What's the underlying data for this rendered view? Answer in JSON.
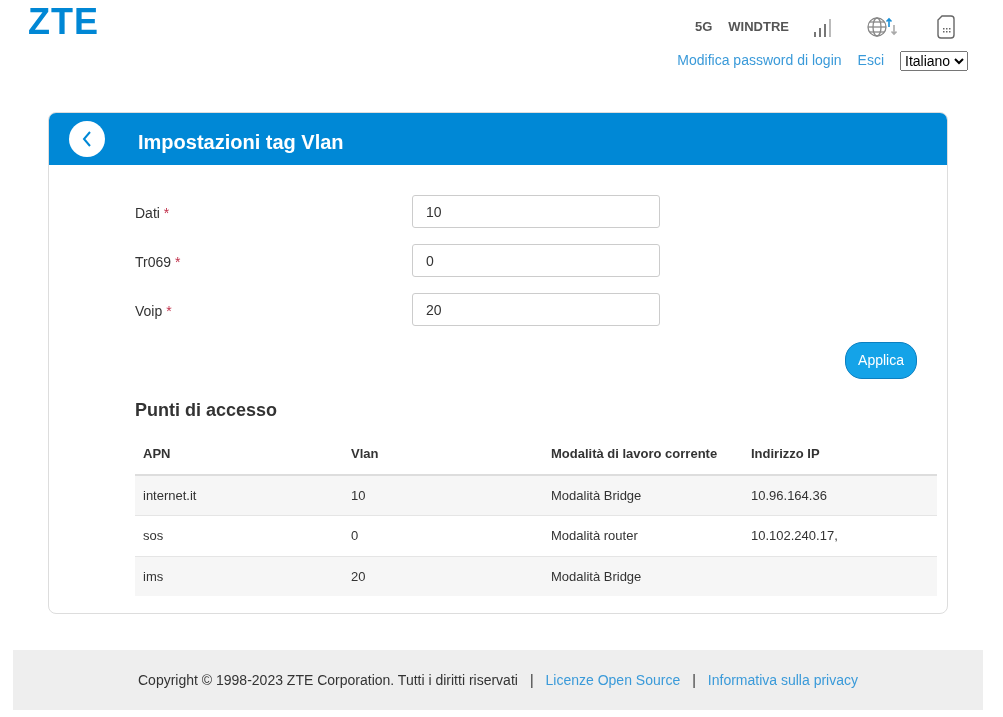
{
  "header": {
    "logo": "ZTE",
    "network": "5G",
    "carrier": "WINDTRE",
    "links": [
      "Modifica password di login",
      "Esci"
    ],
    "language": "Italiano"
  },
  "panel": {
    "title": "Impostazioni tag Vlan",
    "fields": [
      {
        "label": "Dati",
        "required_mark": "*",
        "value": "10"
      },
      {
        "label": "Tr069",
        "required_mark": "*",
        "value": "0"
      },
      {
        "label": "Voip",
        "required_mark": "*",
        "value": "20"
      }
    ],
    "apply_button": "Applica",
    "section_title": "Punti di accesso",
    "table": {
      "columns": [
        "APN",
        "Vlan",
        "Modalità di lavoro corrente",
        "Indirizzo IP"
      ],
      "rows": [
        [
          "internet.it",
          "10",
          "Modalità Bridge",
          "10.96.164.36"
        ],
        [
          "sos",
          "0",
          "Modalità router",
          "10.102.240.17,"
        ],
        [
          "ims",
          "20",
          "Modalità Bridge",
          ""
        ]
      ]
    }
  },
  "footer": {
    "copyright": "Copyright © 1998-2023 ZTE Corporation. Tutti i diritti riservati",
    "separators": [
      "|",
      "|"
    ],
    "links": [
      "Licenze Open Source",
      "Informativa sulla privacy"
    ]
  }
}
